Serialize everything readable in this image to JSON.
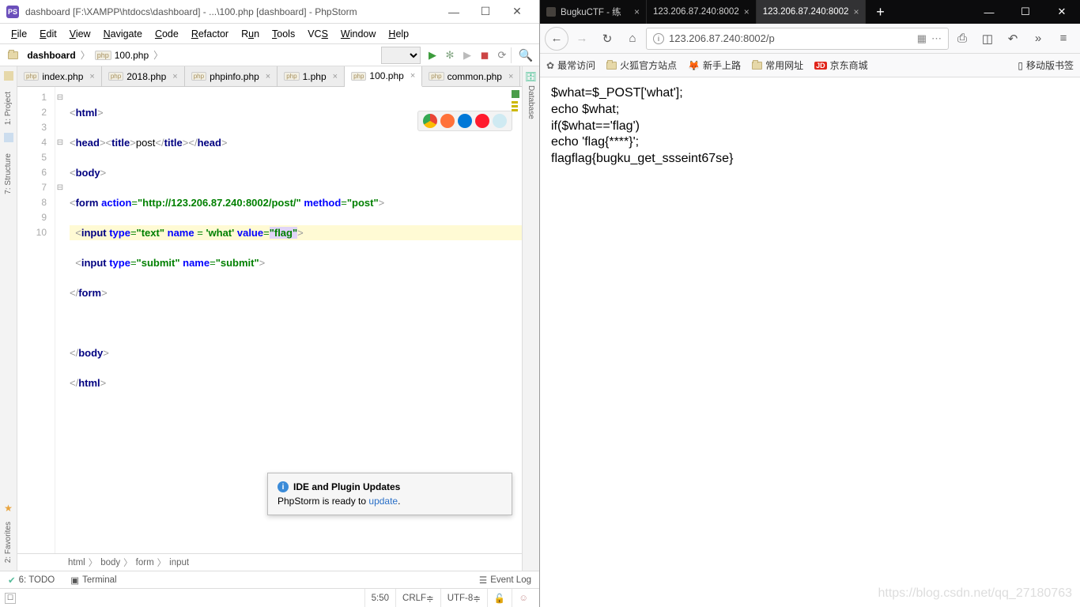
{
  "phpstorm": {
    "title": "dashboard [F:\\XAMPP\\htdocs\\dashboard] - ...\\100.php [dashboard] - PhpStorm",
    "menu": [
      "File",
      "Edit",
      "View",
      "Navigate",
      "Code",
      "Refactor",
      "Run",
      "Tools",
      "VCS",
      "Window",
      "Help"
    ],
    "nav": {
      "folder": "dashboard",
      "file": "100.php"
    },
    "tabs": [
      {
        "label": "index.php",
        "active": false
      },
      {
        "label": "2018.php",
        "active": false
      },
      {
        "label": "phpinfo.php",
        "active": false
      },
      {
        "label": "1.php",
        "active": false
      },
      {
        "label": "100.php",
        "active": true
      },
      {
        "label": "common.php",
        "active": false
      }
    ],
    "line_count": 10,
    "crumbs": [
      "html",
      "body",
      "form",
      "input"
    ],
    "popup": {
      "title": "IDE and Plugin Updates",
      "body": "PhpStorm is ready to ",
      "link": "update"
    },
    "bottom_tools": {
      "todo": "6: TODO",
      "terminal": "Terminal",
      "eventlog": "Event Log"
    },
    "status": {
      "pos": "5:50",
      "sep": "CRLF",
      "enc": "UTF-8"
    },
    "left_strip": {
      "project": "1: Project",
      "structure": "7: Structure",
      "favorites": "2: Favorites"
    },
    "right_strip": {
      "database": "Database"
    },
    "code": {
      "l1_tag": "html",
      "l2_head": "head",
      "l2_title": "title",
      "l2_text": "post",
      "l3_body": "body",
      "l4_form": "form",
      "l4_action_attr": "action",
      "l4_action_val": "\"http://123.206.87.240:8002/post/\"",
      "l4_method_attr": "method",
      "l4_method_val": "\"post\"",
      "l5_input": "input",
      "l5_type": "type",
      "l5_type_val": "\"text\"",
      "l5_name": "name",
      "l5_name_val": "'what'",
      "l5_value": "value",
      "l5_value_val": "\"flag\"",
      "l6_input": "input",
      "l6_type": "type",
      "l6_type_val": "\"submit\"",
      "l6_name": "name",
      "l6_name_val": "\"submit\""
    }
  },
  "firefox": {
    "tabs": [
      {
        "label": "BugkuCTF - 练"
      },
      {
        "label": "123.206.87.240:8002"
      },
      {
        "label": "123.206.87.240:8002"
      }
    ],
    "url": "123.206.87.240:8002/p",
    "bookmarks": {
      "most": "最常访问",
      "fxsite": "火狐官方站点",
      "newbie": "新手上路",
      "common": "常用网址",
      "jd": "京东商城",
      "mobile": "移动版书签"
    },
    "content": {
      "l1": "$what=$_POST['what'];",
      "l2": "echo $what;",
      "l3": "if($what=='flag')",
      "l4": "echo 'flag{****}';",
      "l5": "flagflag{bugku_get_ssseint67se}"
    },
    "watermark": "https://blog.csdn.net/qq_27180763"
  }
}
